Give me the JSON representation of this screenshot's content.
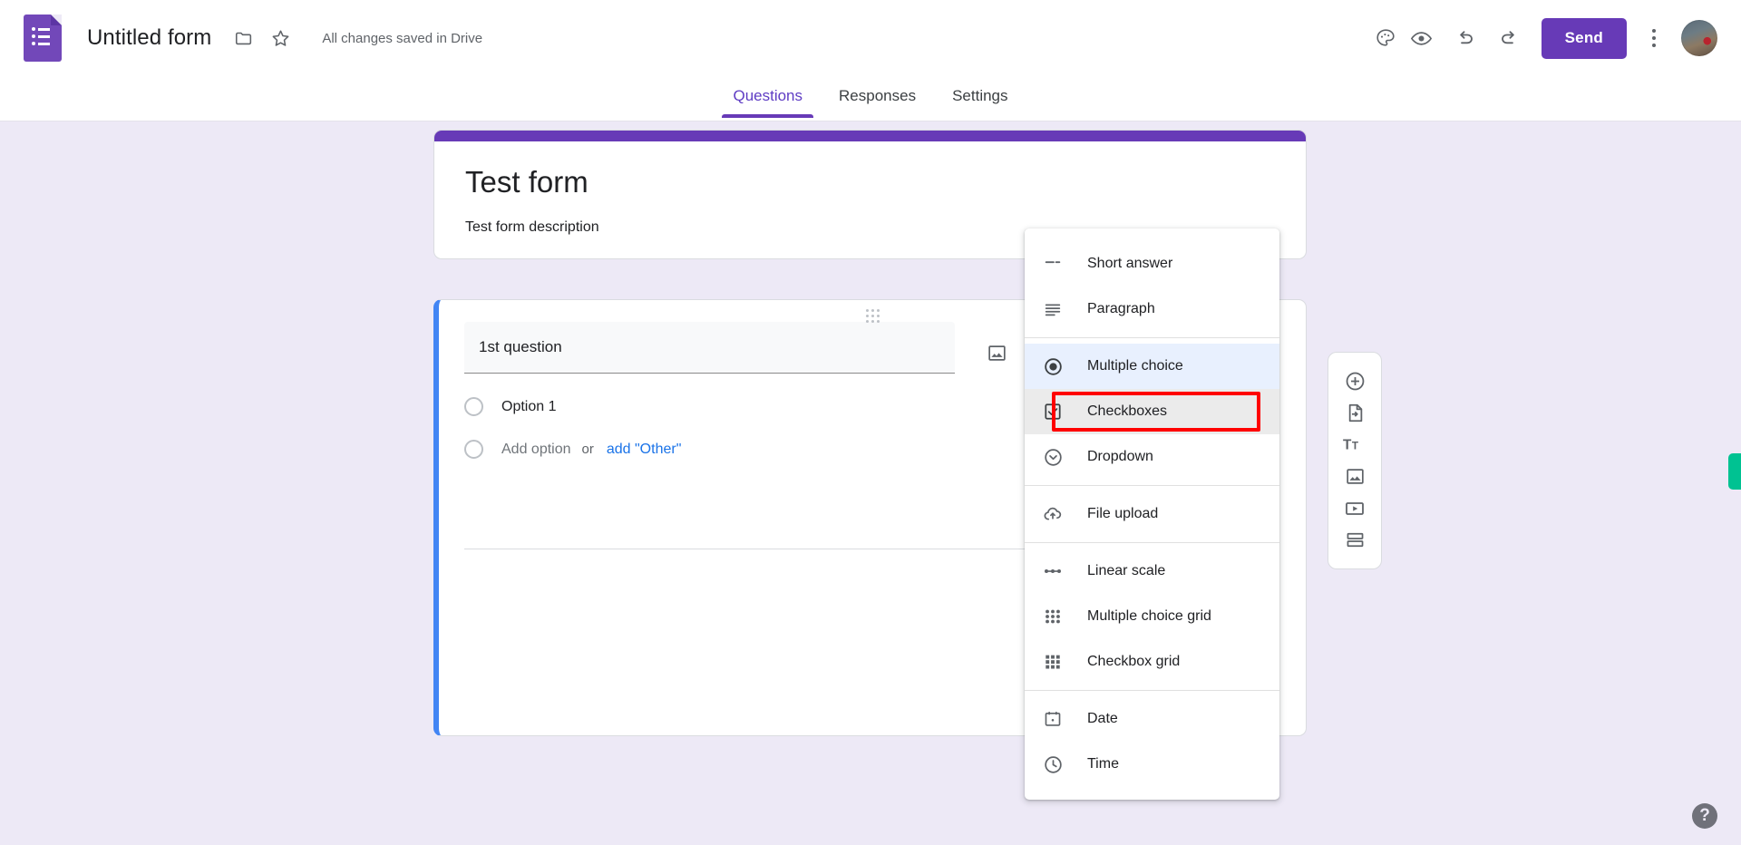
{
  "app": {
    "product": "Google Forms",
    "logo_icon": "google-forms-icon"
  },
  "header": {
    "form_title": "Untitled form",
    "move_folder_icon": "folder-icon",
    "star_icon": "star-icon",
    "save_status": "All changes saved in Drive",
    "theme_icon": "palette-icon",
    "preview_icon": "eye-icon",
    "undo_icon": "undo-icon",
    "redo_icon": "redo-icon",
    "send_label": "Send",
    "more_icon": "kebab-menu-icon",
    "avatar_label": "account-avatar"
  },
  "tabs": [
    {
      "label": "Questions",
      "active": true
    },
    {
      "label": "Responses",
      "active": false
    },
    {
      "label": "Settings",
      "active": false
    }
  ],
  "form_header_card": {
    "title": "Test form",
    "description": "Test form description",
    "accent_color": "#673ab7"
  },
  "question_card": {
    "accent_color": "#4285f4",
    "drag_handle_icon": "drag-handle-icon",
    "question_text": "1st question",
    "add_image_icon": "image-icon",
    "options": [
      {
        "label": "Option 1",
        "icon": "radio-unchecked-icon",
        "placeholder": false
      }
    ],
    "add_option_label": "Add option",
    "or_label": "or",
    "add_other_label": "add \"Other\"",
    "duplicate_icon": "duplicate-icon"
  },
  "side_toolbar": {
    "items": [
      {
        "icon": "add-question-icon",
        "name": "add-question-button"
      },
      {
        "icon": "import-questions-icon",
        "name": "import-questions-button"
      },
      {
        "icon": "add-title-icon",
        "name": "add-title-button"
      },
      {
        "icon": "add-image-icon",
        "name": "add-image-button"
      },
      {
        "icon": "add-video-icon",
        "name": "add-video-button"
      },
      {
        "icon": "add-section-icon",
        "name": "add-section-button"
      }
    ]
  },
  "type_menu": {
    "groups": [
      {
        "items": [
          {
            "label": "Short answer",
            "icon": "short-answer-icon",
            "state": "normal"
          },
          {
            "label": "Paragraph",
            "icon": "paragraph-icon",
            "state": "normal"
          }
        ]
      },
      {
        "items": [
          {
            "label": "Multiple choice",
            "icon": "radio-filled-icon",
            "state": "selected"
          },
          {
            "label": "Checkboxes",
            "icon": "checkbox-checked-icon",
            "state": "hovered",
            "highlight": true
          },
          {
            "label": "Dropdown",
            "icon": "dropdown-circle-icon",
            "state": "normal"
          }
        ]
      },
      {
        "items": [
          {
            "label": "File upload",
            "icon": "cloud-upload-icon",
            "state": "normal"
          }
        ]
      },
      {
        "items": [
          {
            "label": "Linear scale",
            "icon": "linear-scale-icon",
            "state": "normal"
          },
          {
            "label": "Multiple choice grid",
            "icon": "dot-grid-icon",
            "state": "normal"
          },
          {
            "label": "Checkbox grid",
            "icon": "square-grid-icon",
            "state": "normal"
          }
        ]
      },
      {
        "items": [
          {
            "label": "Date",
            "icon": "calendar-icon",
            "state": "normal"
          },
          {
            "label": "Time",
            "icon": "clock-icon",
            "state": "normal"
          }
        ]
      }
    ],
    "highlight_color": "#ff0000"
  },
  "edge_widget": {
    "name": "side-panel-tab",
    "color": "#00c292"
  },
  "help": {
    "label": "?"
  }
}
